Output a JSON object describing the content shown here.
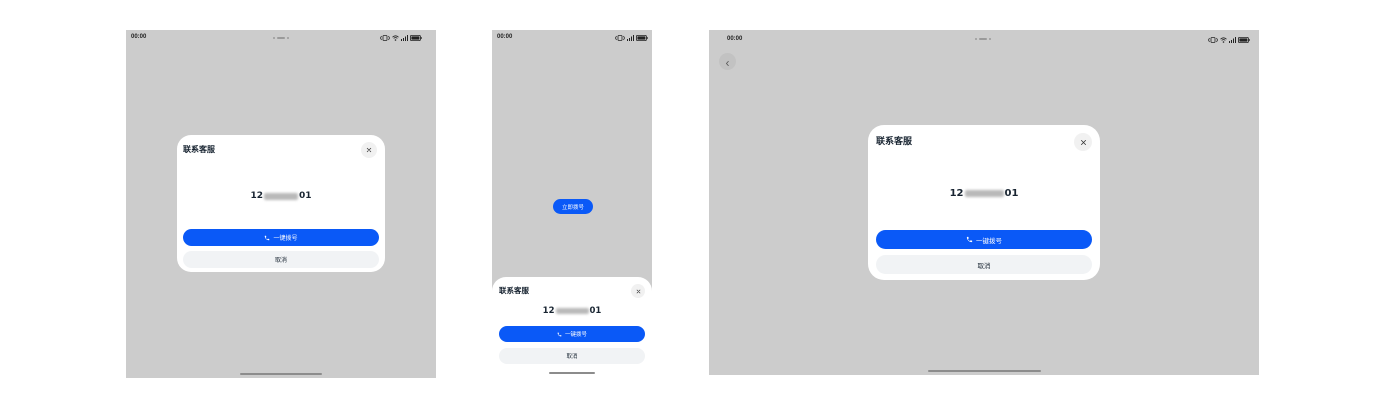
{
  "colors": {
    "page_bg": "#ffffff",
    "screen_bg": "#cccccc",
    "surface": "#ffffff",
    "primary": "#0a59f7",
    "on_primary": "#ffffff",
    "secondary_button": "#f1f3f5",
    "close_button": "#f1f1f1",
    "back_button": "#c2c2c2",
    "text": "#182431",
    "home_indicator": "#8c8c8c"
  },
  "devices": [
    {
      "status_bar": {
        "time": "00:00",
        "icons": [
          "vibrate-icon",
          "wifi-icon",
          "signal-icon",
          "battery-icon"
        ],
        "battery_level": 100
      },
      "dialog": {
        "title": "联系客服",
        "close_icon": "close-icon",
        "phone_number": {
          "prefix": "12",
          "suffix": "01",
          "middle_masked": true
        },
        "call_button": {
          "icon": "phone-icon",
          "label": "一键拨号"
        },
        "cancel_button": {
          "label": "取消"
        }
      }
    },
    {
      "status_bar": {
        "time": "00:00",
        "icons": [
          "vibrate-icon",
          "signal-icon",
          "battery-icon"
        ],
        "battery_level": 100
      },
      "trigger_button": {
        "label": "立即拨号"
      },
      "sheet": {
        "title": "联系客服",
        "close_icon": "close-icon",
        "phone_number": {
          "prefix": "12",
          "suffix": "01",
          "middle_masked": true
        },
        "call_button": {
          "icon": "phone-icon",
          "label": "一键拨号"
        },
        "cancel_button": {
          "label": "取消"
        }
      }
    },
    {
      "status_bar": {
        "time": "00:00",
        "icons": [
          "vibrate-icon",
          "wifi-icon",
          "signal-icon",
          "battery-icon"
        ],
        "battery_level": 100
      },
      "back_button": {
        "icon": "chevron-left-icon"
      },
      "dialog": {
        "title": "联系客服",
        "close_icon": "close-icon",
        "phone_number": {
          "prefix": "12",
          "suffix": "01",
          "middle_masked": true
        },
        "call_button": {
          "icon": "phone-icon",
          "label": "一键拨号"
        },
        "cancel_button": {
          "label": "取消"
        }
      }
    }
  ]
}
